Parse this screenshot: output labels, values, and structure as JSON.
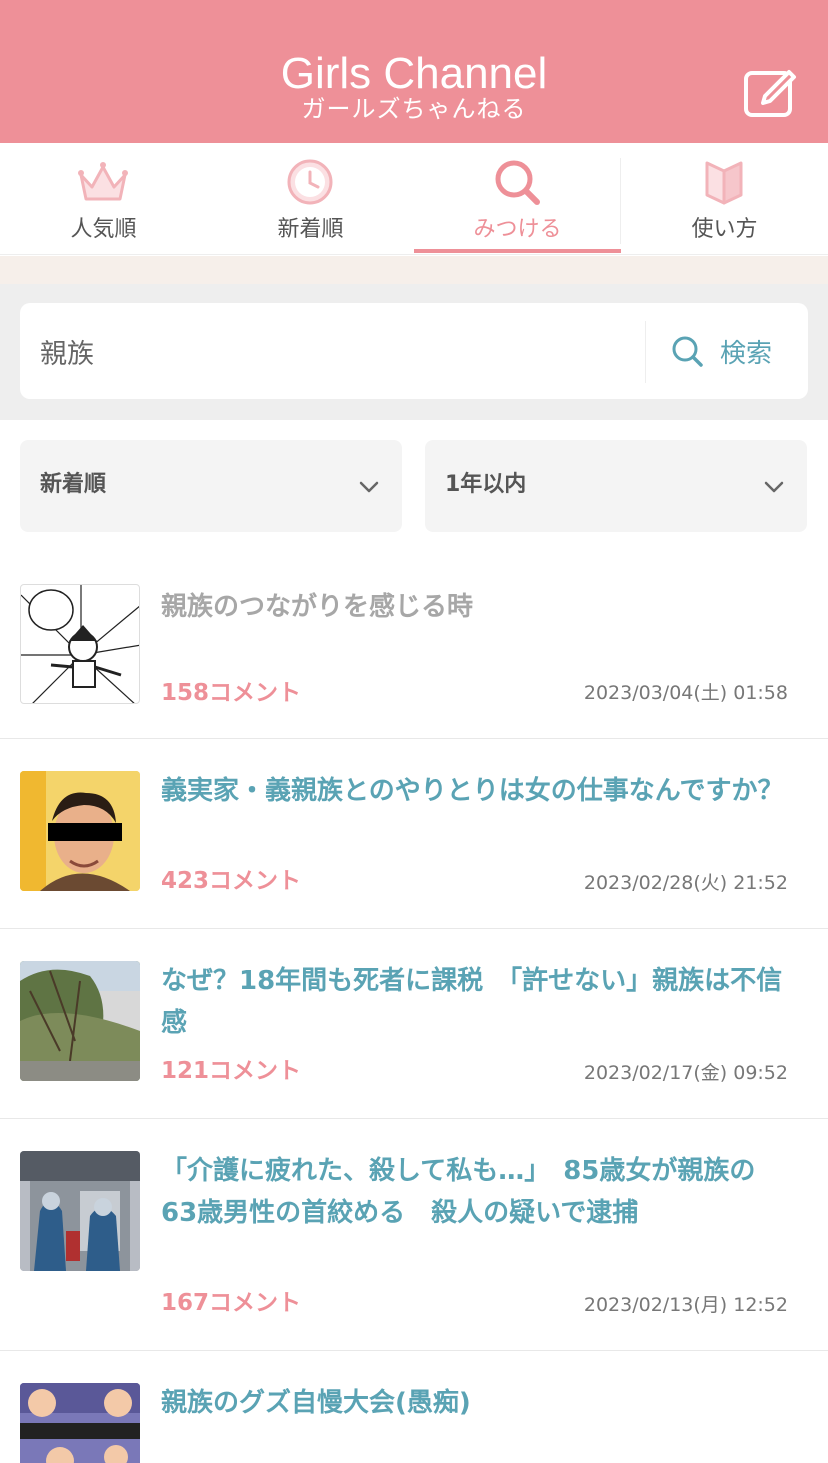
{
  "header": {
    "logo": "Girls Channel",
    "logo_sub": "ガールズちゃんねる",
    "post_icon": "edit-icon"
  },
  "tabs": [
    {
      "label": "人気順",
      "icon": "crown-icon",
      "active": false
    },
    {
      "label": "新着順",
      "icon": "clock-icon",
      "active": false
    },
    {
      "label": "みつける",
      "icon": "search-icon",
      "active": true
    },
    {
      "label": "使い方",
      "icon": "book-icon",
      "active": false
    }
  ],
  "search": {
    "value": "親族",
    "button_label": "検索"
  },
  "filters": {
    "sort": "新着順",
    "period": "1年以内"
  },
  "items": [
    {
      "title": "親族のつながりを感じる時",
      "comments": "158コメント",
      "date": "2023/03/04(土) 01:58",
      "visited": true
    },
    {
      "title": "義実家・義親族とのやりとりは女の仕事なんですか？",
      "comments": "423コメント",
      "date": "2023/02/28(火) 21:52",
      "visited": false
    },
    {
      "title": "なぜ？18年間も死者に課税　「許せない」親族は不信感",
      "comments": "121コメント",
      "date": "2023/02/17(金) 09:52",
      "visited": false
    },
    {
      "title": "「介護に疲れた、殺して私も…」　85歳女が親族の63歳男性の首絞める　殺人の疑いで逮捕",
      "comments": "167コメント",
      "date": "2023/02/13(月) 12:52",
      "visited": false
    },
    {
      "title": "親族のグズ自慢大会(愚痴)",
      "comments": "",
      "date": "",
      "visited": false
    }
  ],
  "colors": {
    "brand": "#ee9098",
    "link": "#5aa3b4",
    "visited": "#a7a7a7"
  }
}
